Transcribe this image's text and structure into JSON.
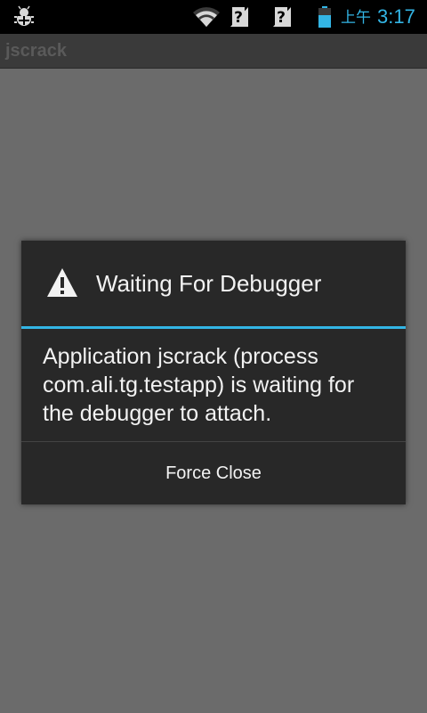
{
  "status_bar": {
    "icons": [
      "debug-icon",
      "wifi-icon",
      "no-sim-signal-icon",
      "no-sim-signal-icon",
      "battery-icon"
    ],
    "ampm": "上午",
    "time": "3:17",
    "accent_color": "#33b5e5"
  },
  "app": {
    "title": "jscrack"
  },
  "dialog": {
    "icon": "warning-icon",
    "title": "Waiting For Debugger",
    "message": "Application jscrack (process com.ali.tg.testapp) is waiting for the debugger to attach.",
    "force_close_label": "Force Close",
    "divider_color": "#33b5e5"
  }
}
